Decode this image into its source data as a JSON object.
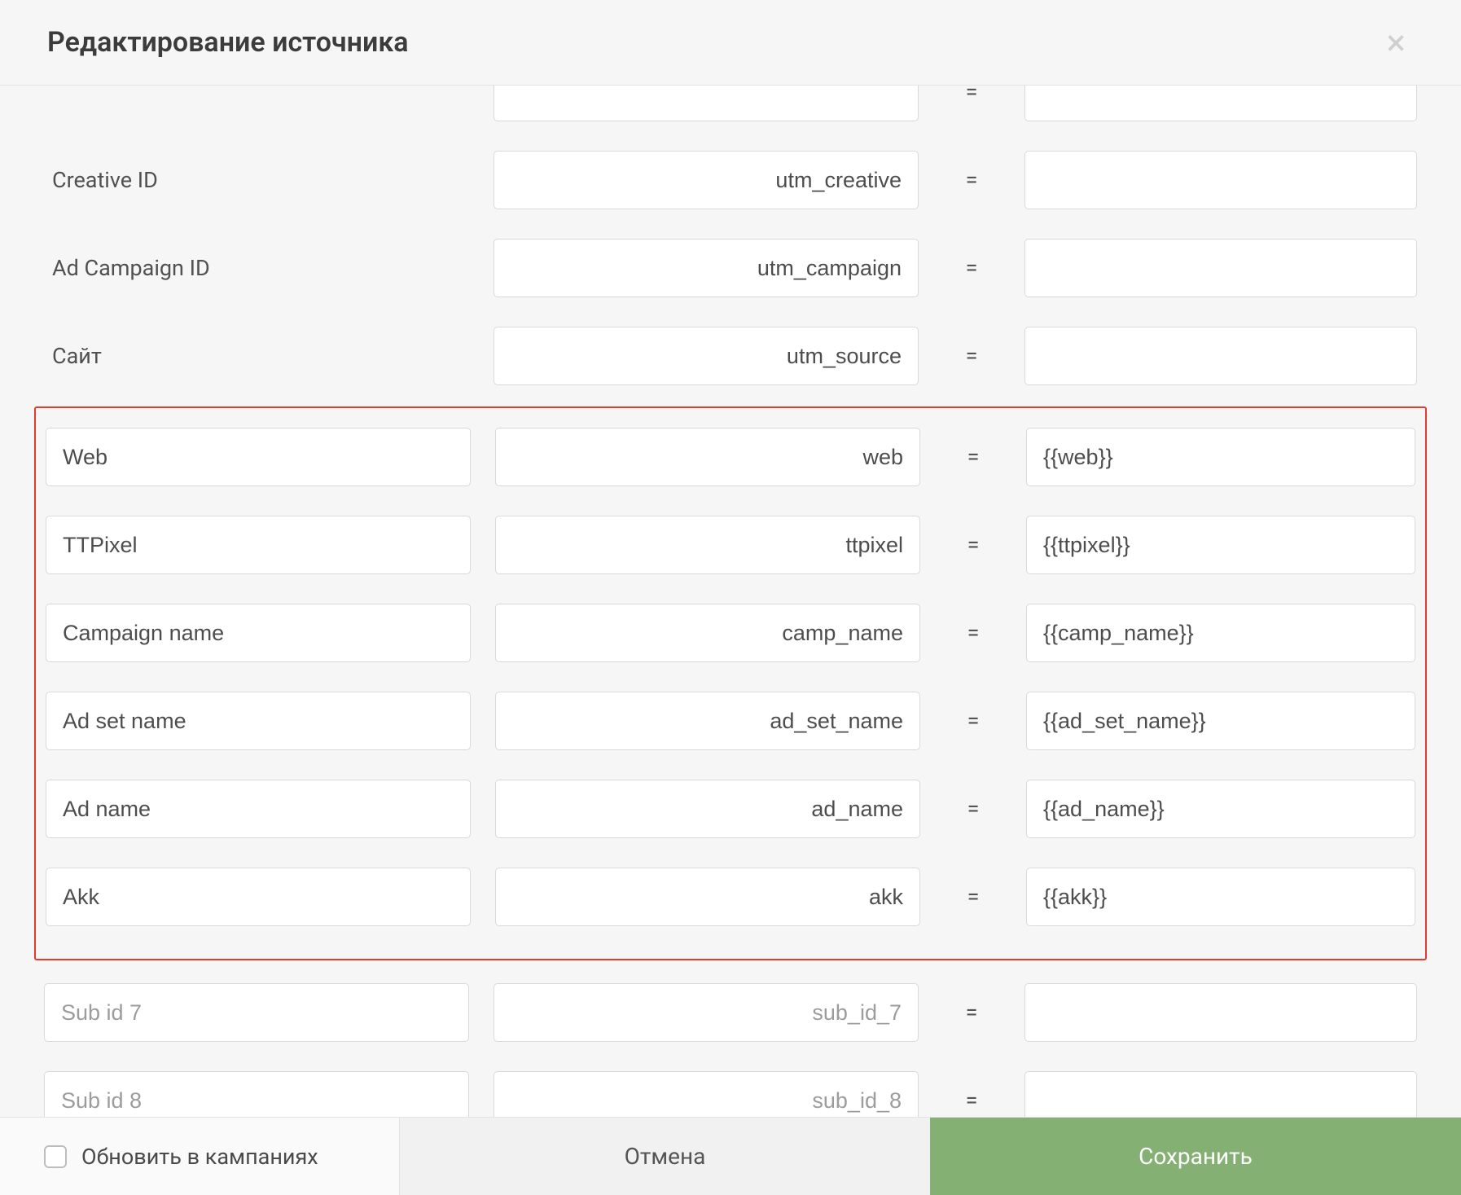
{
  "header": {
    "title": "Редактирование источника",
    "close_icon": "×"
  },
  "rows_top": [
    {
      "label": "",
      "param": "",
      "value": ""
    },
    {
      "label": "Creative ID",
      "param": "utm_creative",
      "value": ""
    },
    {
      "label": "Ad Campaign ID",
      "param": "utm_campaign",
      "value": ""
    },
    {
      "label": "Сайт",
      "param": "utm_source",
      "value": ""
    }
  ],
  "rows_highlight": [
    {
      "name": "Web",
      "param": "web",
      "value": "{{web}}"
    },
    {
      "name": "TTPixel",
      "param": "ttpixel",
      "value": "{{ttpixel}}"
    },
    {
      "name": "Campaign name",
      "param": "camp_name",
      "value": "{{camp_name}}"
    },
    {
      "name": "Ad set name",
      "param": "ad_set_name",
      "value": "{{ad_set_name}}"
    },
    {
      "name": "Ad name",
      "param": "ad_name",
      "value": "{{ad_name}}"
    },
    {
      "name": "Akk",
      "param": "akk",
      "value": "{{akk}}"
    }
  ],
  "rows_bottom": [
    {
      "name_ph": "Sub id 7",
      "param_ph": "sub_id_7",
      "value": ""
    },
    {
      "name_ph": "Sub id 8",
      "param_ph": "sub_id_8",
      "value": ""
    }
  ],
  "eq": "=",
  "footer": {
    "update_label": "Обновить в кампаниях",
    "cancel": "Отмена",
    "save": "Сохранить"
  }
}
